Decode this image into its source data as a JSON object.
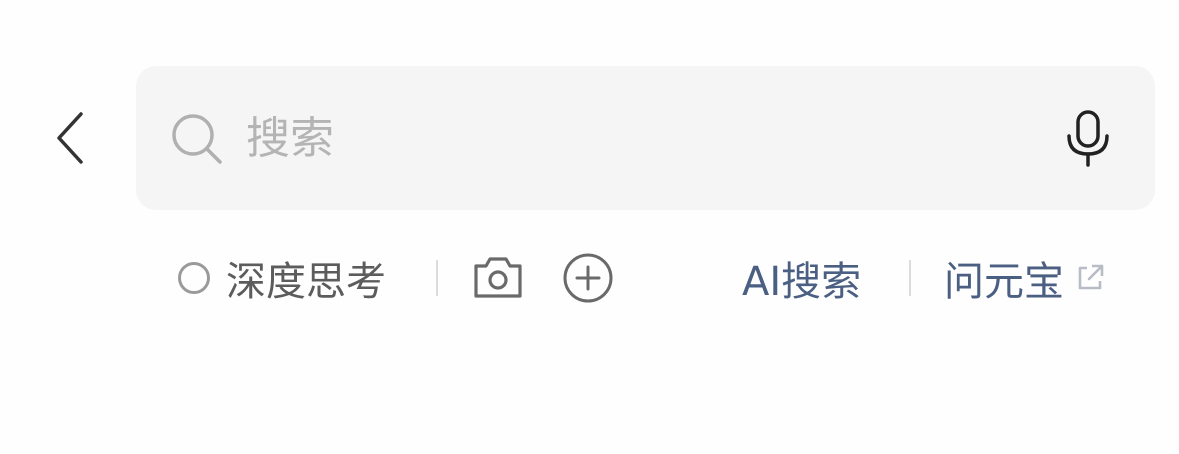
{
  "search": {
    "placeholder": "搜索",
    "value": ""
  },
  "toolbar": {
    "deep_think_label": "深度思考",
    "ai_search_label": "AI搜索",
    "yuanbao_label": "问元宝"
  },
  "colors": {
    "background": "#fefefe",
    "search_bg": "#f5f5f5",
    "placeholder": "#b4b4b4",
    "link_blue": "#4b5f82",
    "icon_gray": "#8a8a8a"
  },
  "icons": {
    "back": "chevron-left-icon",
    "search": "search-icon",
    "mic": "microphone-icon",
    "deep_think": "radio-circle-icon",
    "camera": "camera-icon",
    "plus": "plus-circle-icon",
    "external": "external-link-icon"
  }
}
